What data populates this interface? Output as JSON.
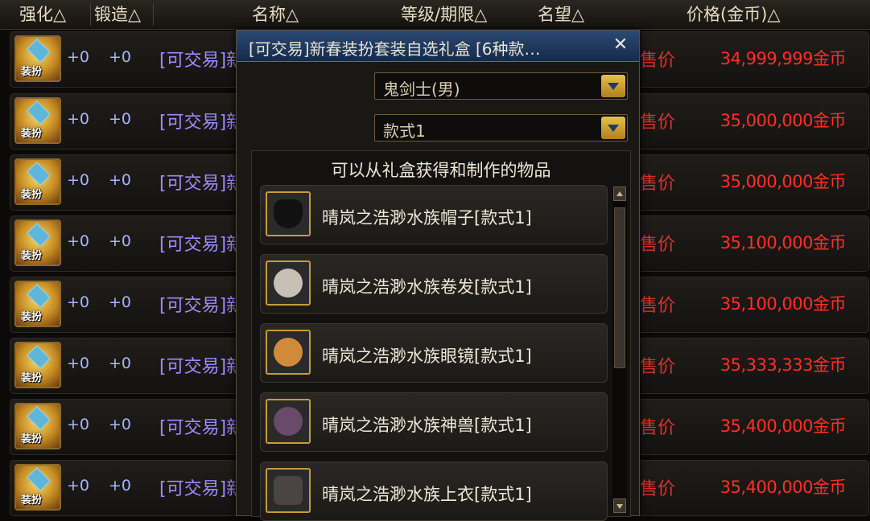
{
  "header": {
    "enhance": "强化△",
    "forge": "锻造△",
    "name": "名称△",
    "level_period": "等级/期限△",
    "reputation": "名望△",
    "price": "价格(金币)△"
  },
  "rows": [
    {
      "icon_tag": "装扮",
      "enhance": "+0",
      "forge": "+0",
      "name": "[可交易]新",
      "sell_label": "售价",
      "price": "34,999,999金币"
    },
    {
      "icon_tag": "装扮",
      "enhance": "+0",
      "forge": "+0",
      "name": "[可交易]新",
      "sell_label": "售价",
      "price": "35,000,000金币"
    },
    {
      "icon_tag": "装扮",
      "enhance": "+0",
      "forge": "+0",
      "name": "[可交易]新",
      "sell_label": "售价",
      "price": "35,000,000金币"
    },
    {
      "icon_tag": "装扮",
      "enhance": "+0",
      "forge": "+0",
      "name": "[可交易]新",
      "sell_label": "售价",
      "price": "35,100,000金币"
    },
    {
      "icon_tag": "装扮",
      "enhance": "+0",
      "forge": "+0",
      "name": "[可交易]新",
      "sell_label": "售价",
      "price": "35,100,000金币"
    },
    {
      "icon_tag": "装扮",
      "enhance": "+0",
      "forge": "+0",
      "name": "[可交易]新",
      "sell_label": "售价",
      "price": "35,333,333金币"
    },
    {
      "icon_tag": "装扮",
      "enhance": "+0",
      "forge": "+0",
      "name": "[可交易]新",
      "sell_label": "售价",
      "price": "35,400,000金币"
    },
    {
      "icon_tag": "装扮",
      "enhance": "+0",
      "forge": "+0",
      "name": "[可交易]新",
      "sell_label": "售价",
      "price": "35,400,000金币"
    }
  ],
  "popup": {
    "title": "[可交易]新春装扮套装自选礼盒 [6种款…",
    "close_label": "✕",
    "class_select": "鬼剑士(男)",
    "style_select": "款式1",
    "list_title": "可以从礼盒获得和制作的物品",
    "items": [
      {
        "name": "晴岚之浩渺水族帽子[款式1]",
        "icon": "hat-icon",
        "color": "#1a1a1a"
      },
      {
        "name": "晴岚之浩渺水族卷发[款式1]",
        "icon": "hair-icon",
        "color": "#c8c0b4"
      },
      {
        "name": "晴岚之浩渺水族眼镜[款式1]",
        "icon": "glasses-icon",
        "color": "#d08a3a"
      },
      {
        "name": "晴岚之浩渺水族神兽[款式1]",
        "icon": "beast-icon",
        "color": "#6a4a6a"
      },
      {
        "name": "晴岚之浩渺水族上衣[款式1]",
        "icon": "coat-icon",
        "color": "#4a4444"
      }
    ]
  }
}
